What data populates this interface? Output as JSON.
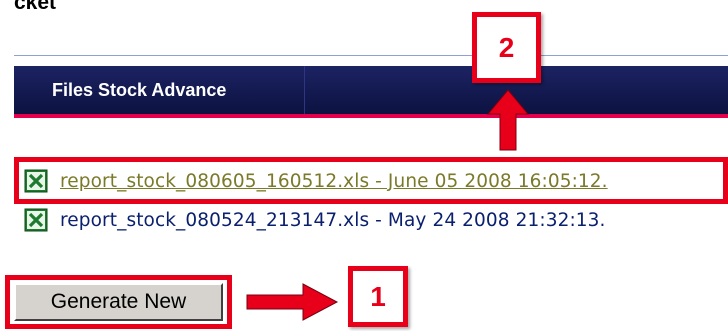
{
  "top_clip_text": "cket",
  "header": {
    "title": "Files Stock Advance"
  },
  "files": [
    {
      "label": "report_stock_080605_160512.xls - June 05 2008 16:05:12.",
      "icon": "excel-file-icon",
      "visited": true
    },
    {
      "label": "report_stock_080524_213147.xls - May 24 2008 21:32:13.",
      "icon": "excel-file-icon",
      "visited": false
    }
  ],
  "generate_button": {
    "label": "Generate New"
  },
  "callouts": {
    "one": "1",
    "two": "2"
  },
  "colors": {
    "header_bg": "#141a52",
    "accent_red": "#e8001a",
    "underline_pink": "#e5004b",
    "link_blue": "#0a1f6e",
    "visited_link": "#7a7a2a",
    "button_face": "#d6d3ce"
  }
}
